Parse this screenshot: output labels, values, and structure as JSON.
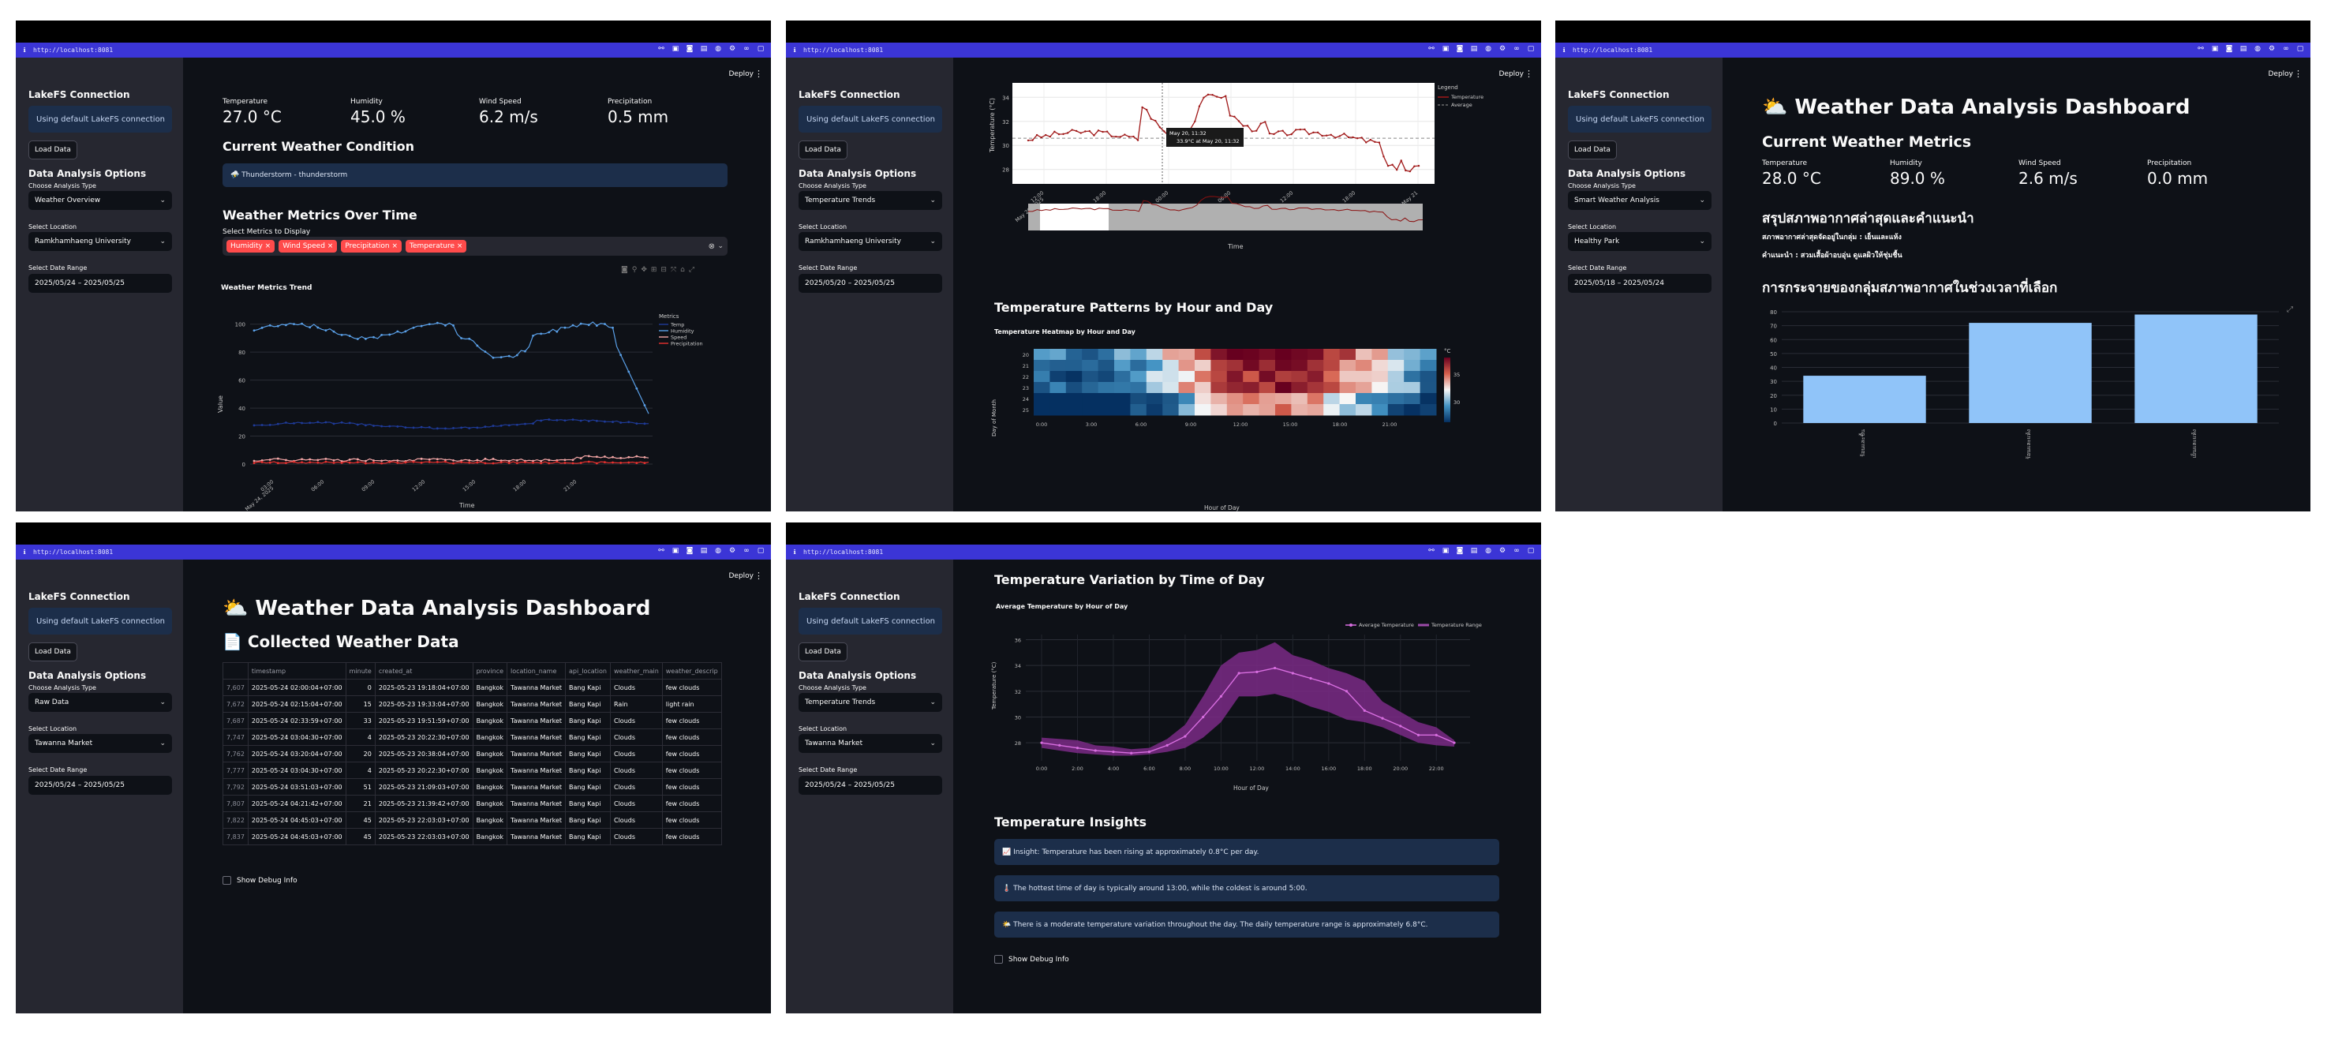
{
  "common": {
    "url": "http://localhost:8081",
    "deploy": "Deploy",
    "sidebar": {
      "section1": "LakeFS Connection",
      "info": "Using default LakeFS connection",
      "load_button": "Load Data",
      "section2": "Data Analysis Options",
      "analysis_label": "Choose Analysis Type",
      "location_label": "Select Location",
      "date_label": "Select Date Range"
    }
  },
  "panel1": {
    "analysis_type": "Weather Overview",
    "location": "Ramkhamhaeng University",
    "date_range": "2025/05/24 – 2025/05/25",
    "metrics": [
      {
        "label": "Temperature",
        "value": "27.0 °C"
      },
      {
        "label": "Humidity",
        "value": "45.0 %"
      },
      {
        "label": "Wind Speed",
        "value": "6.2 m/s"
      },
      {
        "label": "Precipitation",
        "value": "0.5 mm"
      }
    ],
    "condition_heading": "Current Weather Condition",
    "condition_text": "⛈️ Thunderstorm - thunderstorm",
    "over_time_heading": "Weather Metrics Over Time",
    "select_metrics_label": "Select Metrics to Display",
    "chips": [
      "Humidity",
      "Wind Speed",
      "Precipitation",
      "Temperature"
    ],
    "chart_title": "Weather Metrics Trend",
    "y_label": "Value",
    "x_label": "Time",
    "legend_title": "Metrics",
    "y_ticks": [
      "0",
      "20",
      "40",
      "60",
      "80",
      "100"
    ],
    "x_ticks": [
      "03:00\nMay 24, 2025",
      "06:00",
      "09:00",
      "12:00",
      "15:00",
      "18:00",
      "21:00"
    ],
    "legend": [
      "Temp",
      "Humidity",
      "Speed",
      "Precipitation"
    ],
    "colors": {
      "temp": "#1f3b99",
      "humidity": "#5aa0e8",
      "speed": "#f4a6a6",
      "precip": "#e8312f"
    }
  },
  "panel2": {
    "analysis_type": "Temperature Trends",
    "location": "Ramkhamhaeng University",
    "date_range": "2025/05/20 – 2025/05/25",
    "line_y_label": "Temperature (°C)",
    "line_x_label": "Time",
    "line_y_ticks": [
      "34",
      "32",
      "30",
      "28"
    ],
    "line_x_ticks": [
      "12:00\nMay 20, 2025",
      "18:00",
      "00:00",
      "06:00",
      "12:00",
      "18:00",
      "May 21"
    ],
    "legend_title": "Legend",
    "legend": [
      "Temperature",
      "Average"
    ],
    "tooltip_title": "May 20, 11:32",
    "tooltip_value": "33.9°C at May 20, 11:32",
    "patterns_heading": "Temperature Patterns by Hour and Day",
    "heatmap_title": "Temperature Heatmap by Hour and Day",
    "heatmap_y_label": "Day of Month",
    "heatmap_x_label": "Hour of Day",
    "heatmap_rows": [
      "20",
      "21",
      "22",
      "23",
      "24",
      "25"
    ],
    "heatmap_x_ticks": [
      "0:00",
      "3:00",
      "6:00",
      "9:00",
      "12:00",
      "15:00",
      "18:00",
      "21:00"
    ],
    "colorbar_unit": "°C",
    "colorbar_ticks": [
      "35",
      "30"
    ]
  },
  "panel3": {
    "analysis_type": "Smart Weather Analysis",
    "location": "Healthy Park",
    "date_range": "2025/05/18 – 2025/05/24",
    "title": "⛅ Weather Data Analysis Dashboard",
    "metrics_heading": "Current Weather Metrics",
    "metrics": [
      {
        "label": "Temperature",
        "value": "28.0 °C"
      },
      {
        "label": "Humidity",
        "value": "89.0 %"
      },
      {
        "label": "Wind Speed",
        "value": "2.6 m/s"
      },
      {
        "label": "Precipitation",
        "value": "0.0 mm"
      }
    ],
    "thai_heading": "สรุปสภาพอากาศล่าสุดและคำแนะนำ",
    "thai_line1": "สภาพอากาศล่าสุดจัดอยู่ในกลุ่ม : เย็นและแห้ง",
    "thai_line2": "คำแนะนำ : สวมเสื้อผ้าอบอุ่น ดูแลผิวให้ชุ่มชื้น",
    "dist_heading": "การกระจายของกลุ่มสภาพอากาศในช่วงเวลาที่เลือก",
    "bar_y_ticks": [
      "80",
      "70",
      "60",
      "50",
      "40",
      "30",
      "20",
      "10",
      "0"
    ],
    "bar_color": "#90c4f9",
    "chart_data": {
      "type": "bar",
      "categories": [
        "ร้อนและชื้น",
        "ร้อนและแห้ง",
        "เย็นและแห้ง"
      ],
      "values": [
        34,
        72,
        78
      ],
      "ylim": [
        0,
        80
      ]
    }
  },
  "panel4": {
    "analysis_type": "Raw Data",
    "location": "Tawanna Market",
    "date_range": "2025/05/24 – 2025/05/25",
    "title": "⛅ Weather Data Analysis Dashboard",
    "collected_heading": "📄 Collected Weather Data",
    "columns": [
      "",
      "timestamp",
      "minute",
      "created_at",
      "province",
      "location_name",
      "api_location",
      "weather_main",
      "weather_descrip"
    ],
    "rows": [
      [
        "7,607",
        "2025-05-24 02:00:04+07:00",
        "0",
        "2025-05-23 19:18:04+07:00",
        "Bangkok",
        "Tawanna Market",
        "Bang Kapi",
        "Clouds",
        "few clouds"
      ],
      [
        "7,672",
        "2025-05-24 02:15:04+07:00",
        "15",
        "2025-05-23 19:33:04+07:00",
        "Bangkok",
        "Tawanna Market",
        "Bang Kapi",
        "Rain",
        "light rain"
      ],
      [
        "7,687",
        "2025-05-24 02:33:59+07:00",
        "33",
        "2025-05-23 19:51:59+07:00",
        "Bangkok",
        "Tawanna Market",
        "Bang Kapi",
        "Clouds",
        "few clouds"
      ],
      [
        "7,747",
        "2025-05-24 03:04:30+07:00",
        "4",
        "2025-05-23 20:22:30+07:00",
        "Bangkok",
        "Tawanna Market",
        "Bang Kapi",
        "Clouds",
        "few clouds"
      ],
      [
        "7,762",
        "2025-05-24 03:20:04+07:00",
        "20",
        "2025-05-23 20:38:04+07:00",
        "Bangkok",
        "Tawanna Market",
        "Bang Kapi",
        "Clouds",
        "few clouds"
      ],
      [
        "7,777",
        "2025-05-24 03:04:30+07:00",
        "4",
        "2025-05-23 20:22:30+07:00",
        "Bangkok",
        "Tawanna Market",
        "Bang Kapi",
        "Clouds",
        "few clouds"
      ],
      [
        "7,792",
        "2025-05-24 03:51:03+07:00",
        "51",
        "2025-05-23 21:09:03+07:00",
        "Bangkok",
        "Tawanna Market",
        "Bang Kapi",
        "Clouds",
        "few clouds"
      ],
      [
        "7,807",
        "2025-05-24 04:21:42+07:00",
        "21",
        "2025-05-23 21:39:42+07:00",
        "Bangkok",
        "Tawanna Market",
        "Bang Kapi",
        "Clouds",
        "few clouds"
      ],
      [
        "7,822",
        "2025-05-24 04:45:03+07:00",
        "45",
        "2025-05-23 22:03:03+07:00",
        "Bangkok",
        "Tawanna Market",
        "Bang Kapi",
        "Clouds",
        "few clouds"
      ],
      [
        "7,837",
        "2025-05-24 04:45:03+07:00",
        "45",
        "2025-05-23 22:03:03+07:00",
        "Bangkok",
        "Tawanna Market",
        "Bang Kapi",
        "Clouds",
        "few clouds"
      ]
    ],
    "debug_label": "Show Debug Info"
  },
  "panel5": {
    "analysis_type": "Temperature Trends",
    "location": "Tawanna Market",
    "date_range": "2025/05/24 – 2025/05/25",
    "variation_heading": "Temperature Variation by Time of Day",
    "chart_title": "Average Temperature by Hour of Day",
    "legend": [
      "Average Temperature",
      "Temperature Range"
    ],
    "y_label": "Temperature (°C)",
    "x_label": "Hour of Day",
    "y_ticks": [
      "36",
      "34",
      "32",
      "30",
      "28"
    ],
    "x_ticks": [
      "0:00",
      "2:00",
      "4:00",
      "6:00",
      "8:00",
      "10:00",
      "12:00",
      "14:00",
      "16:00",
      "18:00",
      "20:00",
      "22:00"
    ],
    "line_color": "#d86ee0",
    "band_color": "#7a2a86",
    "chart_data": {
      "type": "line",
      "x": [
        0,
        1,
        2,
        3,
        4,
        5,
        6,
        7,
        8,
        9,
        10,
        11,
        12,
        13,
        14,
        15,
        16,
        17,
        18,
        19,
        20,
        21,
        22,
        23
      ],
      "series": [
        {
          "name": "Average Temperature",
          "values": [
            28.0,
            27.8,
            27.6,
            27.4,
            27.3,
            27.2,
            27.3,
            27.8,
            28.5,
            30.0,
            31.6,
            33.4,
            33.5,
            33.8,
            33.4,
            33.0,
            32.6,
            32.0,
            30.5,
            29.9,
            29.3,
            28.6,
            28.6,
            28.0
          ]
        },
        {
          "name": "Temperature Range",
          "lower": [
            27.6,
            27.4,
            27.2,
            27.1,
            27.0,
            27.0,
            27.1,
            27.3,
            27.6,
            28.4,
            29.6,
            31.6,
            31.6,
            31.8,
            31.4,
            30.8,
            30.4,
            29.8,
            29.6,
            29.2,
            28.6,
            28.0,
            27.8,
            27.7
          ],
          "upper": [
            28.4,
            28.3,
            28.2,
            27.8,
            27.7,
            27.5,
            27.6,
            28.3,
            29.4,
            31.6,
            34.0,
            35.0,
            35.2,
            35.8,
            34.8,
            34.4,
            33.8,
            33.4,
            32.8,
            31.2,
            30.4,
            29.6,
            29.2,
            28.2
          ]
        }
      ]
    },
    "insights_heading": "Temperature Insights",
    "insights": [
      "📈 Insight: Temperature has been rising at approximately 0.8°C per day.",
      "🌡️ The hottest time of day is typically around 13:00, while the coldest is around 5:00.",
      "🌤️ There is a moderate temperature variation throughout the day. The daily temperature range is approximately 6.8°C."
    ],
    "debug_label": "Show Debug Info"
  }
}
